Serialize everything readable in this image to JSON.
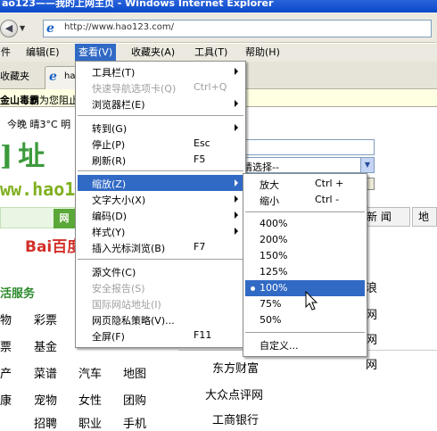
{
  "window": {
    "title": "ao123——我的上网主页 - Windows Internet Explorer"
  },
  "address": {
    "url": "http://www.hao123.com/"
  },
  "menubar": {
    "items": [
      "编辑(E)",
      "查看(V)",
      "收藏夹(A)",
      "工具(T)",
      "帮助(H)"
    ],
    "first_char": "件"
  },
  "tabs": {
    "favorites_label": "收藏夹",
    "tab_title": "ha"
  },
  "security_bar": {
    "text_bold": "金山毒霸",
    "text": "为您阻止"
  },
  "page": {
    "weather": "今晚 晴3°C 明",
    "logo_text": "]址",
    "logo_url": "ww.hao1",
    "select_placeholder": "请选择--",
    "green_tab": "网",
    "baidu": "Bai百度",
    "life_title": "活服务",
    "life_rows": [
      [
        "物",
        "彩票"
      ],
      [
        "票",
        "基金",
        "银行",
        "旅游"
      ],
      [
        "产",
        "菜谱",
        "汽车",
        "地图"
      ],
      [
        "康",
        "宠物",
        "女性",
        "团购"
      ],
      [
        "",
        "招聘",
        "职业",
        "手机"
      ]
    ],
    "news_tab": "新 闻",
    "map_tab": "地",
    "right_sites": [
      "东方财富",
      "大众点评网",
      "工商银行"
    ],
    "right_fragments": [
      "浪",
      "网",
      "网",
      "网"
    ]
  },
  "view_menu": {
    "items": [
      {
        "label": "工具栏(T)",
        "shortcut": "",
        "submenu": true,
        "disabled": false
      },
      {
        "label": "快速导航选项卡(Q)",
        "shortcut": "Ctrl+Q",
        "submenu": false,
        "disabled": true
      },
      {
        "label": "浏览器栏(E)",
        "shortcut": "",
        "submenu": true,
        "disabled": false
      },
      {
        "label": "转到(G)",
        "shortcut": "",
        "submenu": true,
        "disabled": false
      },
      {
        "label": "停止(P)",
        "shortcut": "Esc",
        "submenu": false,
        "disabled": false
      },
      {
        "label": "刷新(R)",
        "shortcut": "F5",
        "submenu": false,
        "disabled": false
      },
      {
        "label": "缩放(Z)",
        "shortcut": "",
        "submenu": true,
        "disabled": false,
        "highlighted": true
      },
      {
        "label": "文字大小(X)",
        "shortcut": "",
        "submenu": true,
        "disabled": false
      },
      {
        "label": "编码(D)",
        "shortcut": "",
        "submenu": true,
        "disabled": false
      },
      {
        "label": "样式(Y)",
        "shortcut": "",
        "submenu": true,
        "disabled": false
      },
      {
        "label": "插入光标浏览(B)",
        "shortcut": "F7",
        "submenu": false,
        "disabled": false
      },
      {
        "label": "源文件(C)",
        "shortcut": "",
        "submenu": false,
        "disabled": false
      },
      {
        "label": "安全报告(S)",
        "shortcut": "",
        "submenu": false,
        "disabled": true
      },
      {
        "label": "国际网站地址(I)",
        "shortcut": "",
        "submenu": false,
        "disabled": true
      },
      {
        "label": "网页隐私策略(V)...",
        "shortcut": "",
        "submenu": false,
        "disabled": false
      },
      {
        "label": "全屏(F)",
        "shortcut": "F11",
        "submenu": false,
        "disabled": false
      }
    ]
  },
  "zoom_menu": {
    "items": [
      {
        "label": "放大",
        "shortcut": "Ctrl +"
      },
      {
        "label": "缩小",
        "shortcut": "Ctrl -"
      },
      {
        "label": "400%",
        "shortcut": ""
      },
      {
        "label": "200%",
        "shortcut": ""
      },
      {
        "label": "150%",
        "shortcut": ""
      },
      {
        "label": "125%",
        "shortcut": ""
      },
      {
        "label": "100%",
        "shortcut": "",
        "selected": true
      },
      {
        "label": "75%",
        "shortcut": ""
      },
      {
        "label": "50%",
        "shortcut": ""
      },
      {
        "label": "自定义...",
        "shortcut": ""
      }
    ],
    "selected_value": "100%"
  },
  "colors": {
    "highlight": "#316ac5",
    "titlebar": "#0a48c8",
    "menubar": "#eceae0"
  }
}
